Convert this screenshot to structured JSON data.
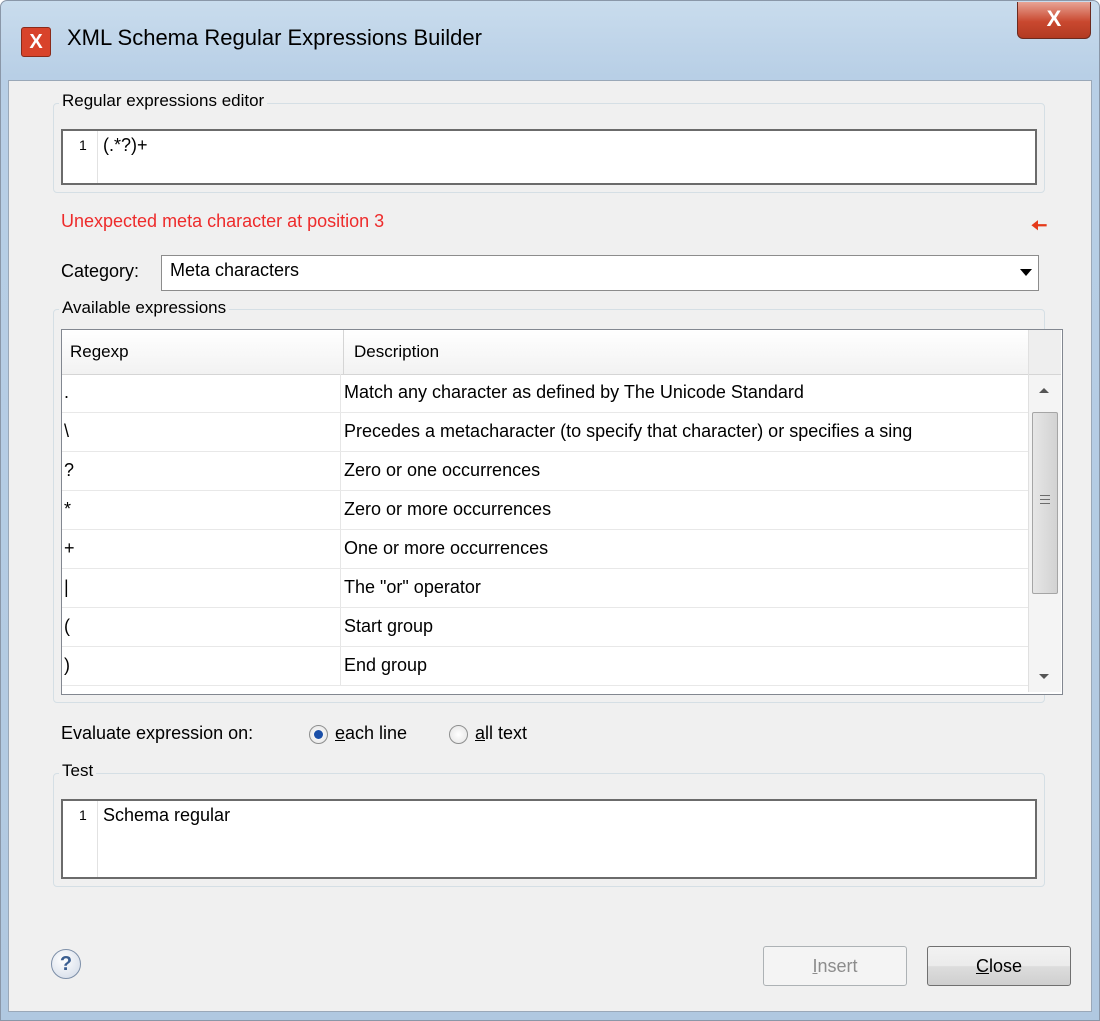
{
  "window": {
    "title": "XML Schema Regular Expressions Builder"
  },
  "icons": {
    "app": "app-icon",
    "close": "close-icon",
    "help": "help-icon",
    "error_arrow": "arrow-left-icon"
  },
  "close_glyph": "X",
  "regex_editor": {
    "label": "Regular expressions editor",
    "line_number": "1",
    "text": "(.*?)+"
  },
  "error_message": "Unexpected meta character at position 3",
  "category": {
    "label": "Category:",
    "value": "Meta characters"
  },
  "available": {
    "label": "Available expressions",
    "columns": [
      "Regexp",
      "Description"
    ],
    "rows": [
      {
        "regexp": ".",
        "description": "Match any character as defined by The Unicode Standard"
      },
      {
        "regexp": "\\",
        "description": "Precedes a metacharacter (to specify that character) or specifies a sing"
      },
      {
        "regexp": "?",
        "description": "Zero or one occurrences"
      },
      {
        "regexp": "*",
        "description": "Zero or more occurrences"
      },
      {
        "regexp": "+",
        "description": "One or more occurrences"
      },
      {
        "regexp": "|",
        "description": "The \"or\" operator"
      },
      {
        "regexp": "(",
        "description": "Start group"
      },
      {
        "regexp": ")",
        "description": "End group"
      }
    ]
  },
  "evaluate": {
    "label": "Evaluate expression on:",
    "options": [
      {
        "mnemonic": "e",
        "rest": "ach line",
        "selected": true
      },
      {
        "mnemonic": "a",
        "rest": "ll text",
        "selected": false
      }
    ]
  },
  "test": {
    "label": "Test",
    "line_number": "1",
    "text": "Schema regular"
  },
  "buttons": {
    "insert": {
      "mnemonic": "I",
      "rest": "nsert",
      "enabled": false
    },
    "close": {
      "mnemonic": "C",
      "rest": "lose",
      "enabled": true
    }
  },
  "colors": {
    "error": "#ee2b2b",
    "radio_selected": "#1a4fa8"
  }
}
